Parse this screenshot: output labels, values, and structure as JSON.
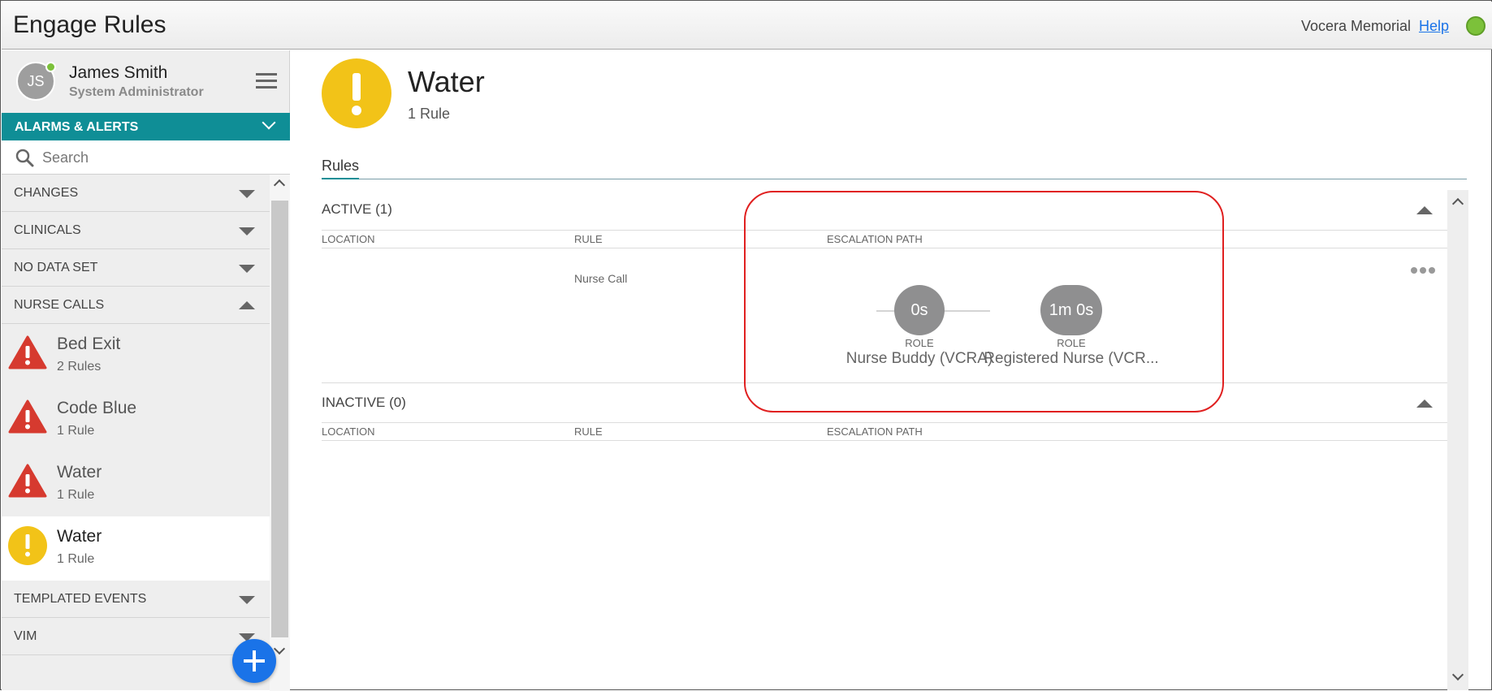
{
  "header": {
    "app_title": "Engage Rules",
    "organization": "Vocera Memorial",
    "help_label": "Help",
    "status_color": "#7cc13a"
  },
  "user": {
    "initials": "JS",
    "name": "James Smith",
    "role": "System Administrator"
  },
  "sidebar": {
    "section_label": "ALARMS & ALERTS",
    "search_placeholder": "Search",
    "groups": [
      {
        "label": "CHANGES",
        "expanded": false
      },
      {
        "label": "CLINICALS",
        "expanded": false
      },
      {
        "label": "NO DATA SET",
        "expanded": false
      },
      {
        "label": "NURSE CALLS",
        "expanded": true
      },
      {
        "label": "TEMPLATED EVENTS",
        "expanded": false
      },
      {
        "label": "VIM",
        "expanded": false
      }
    ],
    "items": [
      {
        "title": "Bed Exit",
        "subtitle": "2 Rules",
        "icon": "red-warning-triangle-icon"
      },
      {
        "title": "Code Blue",
        "subtitle": "1 Rule",
        "icon": "red-warning-triangle-icon"
      },
      {
        "title": "Water",
        "subtitle": "1 Rule",
        "icon": "red-warning-triangle-icon"
      },
      {
        "title": "Water",
        "subtitle": "1 Rule",
        "icon": "yellow-alert-circle-icon",
        "selected": true
      }
    ]
  },
  "main": {
    "title": "Water",
    "subtitle": "1 Rule",
    "icon": "yellow-alert-circle-icon",
    "tab": "Rules",
    "active_section": {
      "label": "ACTIVE (1)",
      "columns": [
        "LOCATION",
        "RULE",
        "ESCALATION PATH"
      ],
      "rows": [
        {
          "location": "",
          "rule": "Nurse Call",
          "escalation": [
            {
              "time": "0s",
              "type": "ROLE",
              "name": "Nurse Buddy (VCRA)"
            },
            {
              "time": "1m 0s",
              "type": "ROLE",
              "name": "Registered Nurse (VCR..."
            }
          ]
        }
      ]
    },
    "inactive_section": {
      "label": "INACTIVE (0)",
      "columns": [
        "LOCATION",
        "RULE",
        "ESCALATION PATH"
      ]
    }
  },
  "colors": {
    "accent": "#0f8e96",
    "link": "#1a73e8",
    "alert_yellow": "#f2c318",
    "alert_red": "#d63a2f",
    "node_gray": "#8f8f90",
    "highlight_red": "#e02020"
  }
}
